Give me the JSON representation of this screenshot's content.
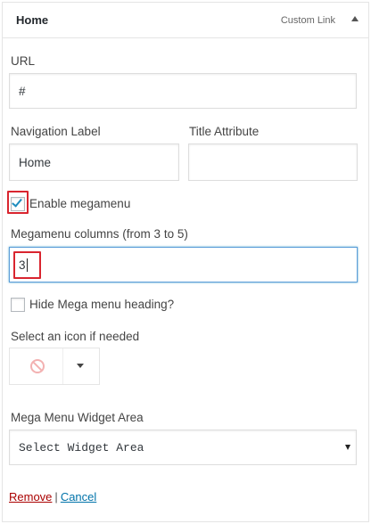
{
  "menu_item": {
    "title": "Home",
    "type": "Custom Link"
  },
  "url": {
    "label": "URL",
    "value": "#"
  },
  "navigation_label": {
    "label": "Navigation Label",
    "value": "Home"
  },
  "title_attribute": {
    "label": "Title Attribute",
    "value": ""
  },
  "enable_megamenu": {
    "label": "Enable megamenu",
    "checked": true
  },
  "megamenu_columns": {
    "label": "Megamenu columns (from 3 to 5)",
    "value": "3"
  },
  "hide_heading": {
    "label": "Hide Mega menu heading?",
    "checked": false
  },
  "icon": {
    "label": "Select an icon if needed",
    "current": "prohibited-icon"
  },
  "widget_area": {
    "label": "Mega Menu Widget Area",
    "selected": "Select Widget Area"
  },
  "actions": {
    "remove": "Remove",
    "separator": "|",
    "cancel": "Cancel"
  },
  "colors": {
    "highlight": "#d9252f",
    "checkmark": "#1e8cbe",
    "remove_link": "#aa0000",
    "cancel_link": "#0073aa"
  }
}
